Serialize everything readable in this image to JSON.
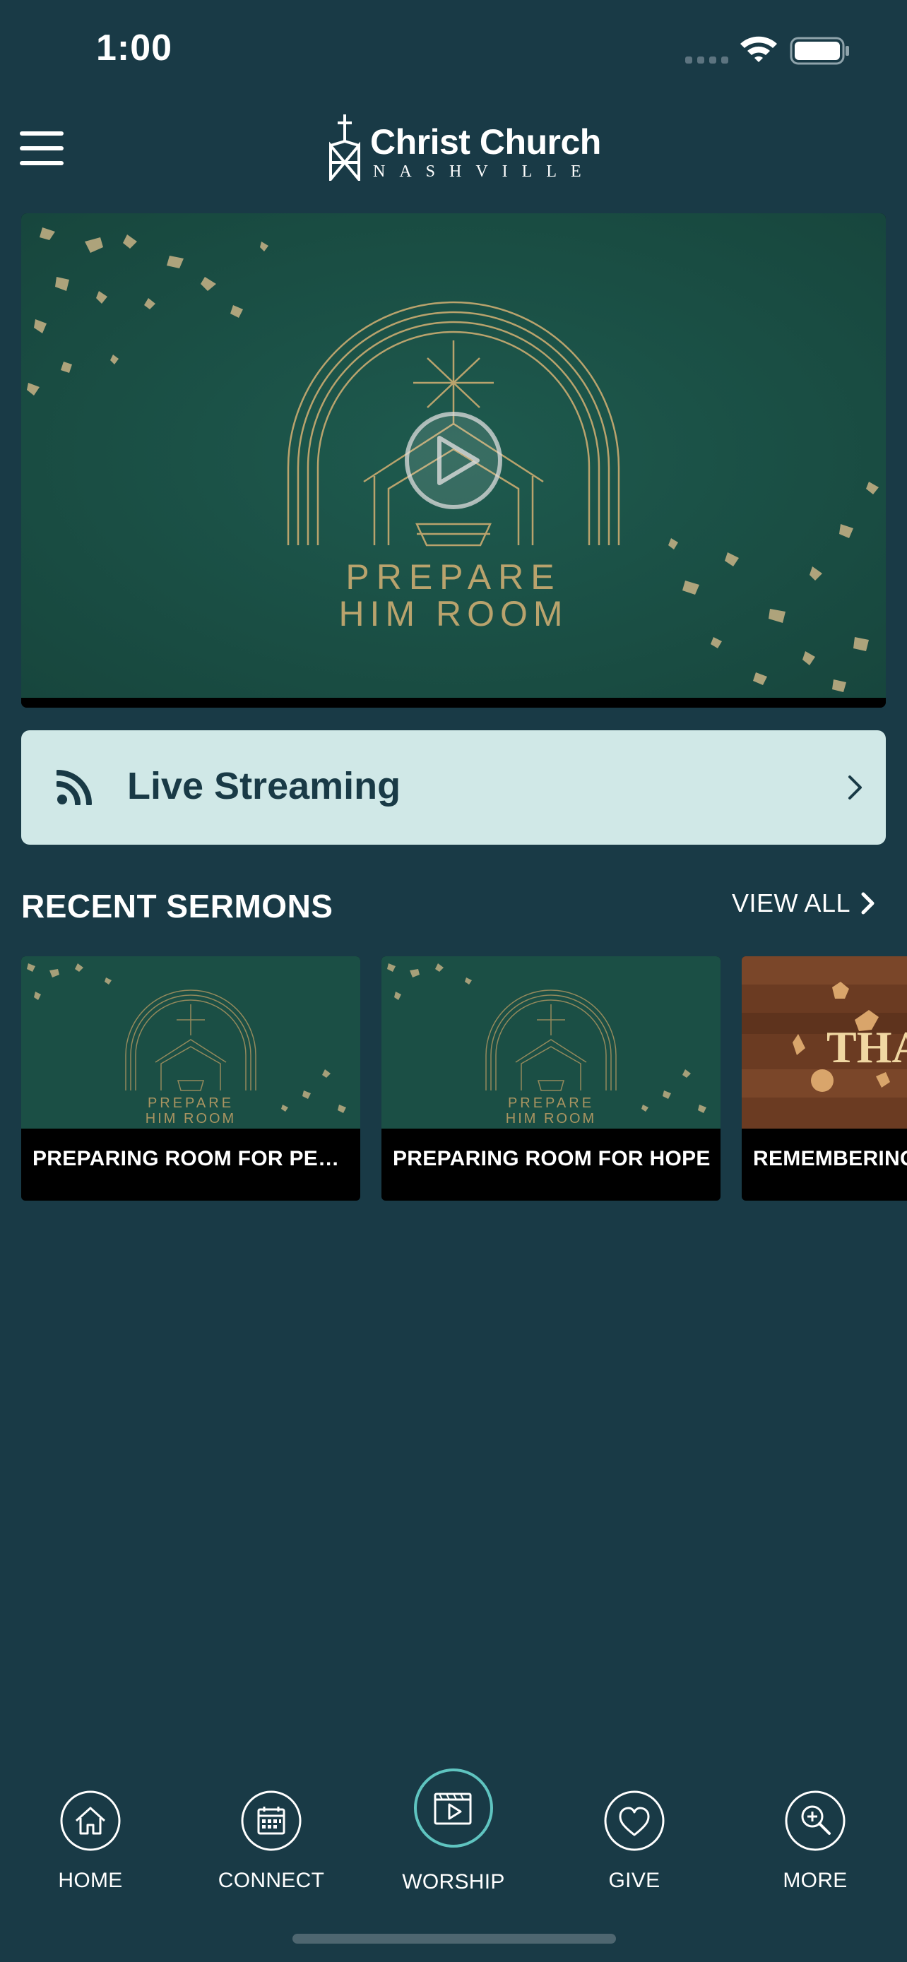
{
  "status_bar": {
    "time": "1:00"
  },
  "header": {
    "logo_title": "Christ Church",
    "logo_subtitle": "NASHVILLE",
    "menu_icon": "hamburger-icon"
  },
  "hero": {
    "title_line1": "PREPARE",
    "title_line2": "HIM ROOM",
    "play_icon": "play-icon"
  },
  "live": {
    "label": "Live Streaming",
    "icon": "rss-icon"
  },
  "sermons": {
    "title": "RECENT SERMONS",
    "view_all": "VIEW ALL",
    "items": [
      {
        "title": "PREPARING ROOM FOR PEA...",
        "thumb": "prepare-him-room"
      },
      {
        "title": "PREPARING ROOM FOR HOPE",
        "thumb": "prepare-him-room"
      },
      {
        "title": "REMEMBERING",
        "thumb": "thanksgiving"
      }
    ],
    "thumb_text": {
      "line1": "PREPARE",
      "line2": "HIM ROOM",
      "thanks": "THAN"
    }
  },
  "tabs": [
    {
      "label": "HOME",
      "icon": "home-icon"
    },
    {
      "label": "CONNECT",
      "icon": "calendar-icon"
    },
    {
      "label": "WORSHIP",
      "icon": "video-play-icon",
      "active": true
    },
    {
      "label": "GIVE",
      "icon": "heart-icon"
    },
    {
      "label": "MORE",
      "icon": "search-plus-icon"
    }
  ],
  "colors": {
    "background": "#193a46",
    "hero_green": "#1c5046",
    "gold": "#b9a36d",
    "live_card": "#d0e8e7",
    "active_ring": "#5fc4c0"
  }
}
